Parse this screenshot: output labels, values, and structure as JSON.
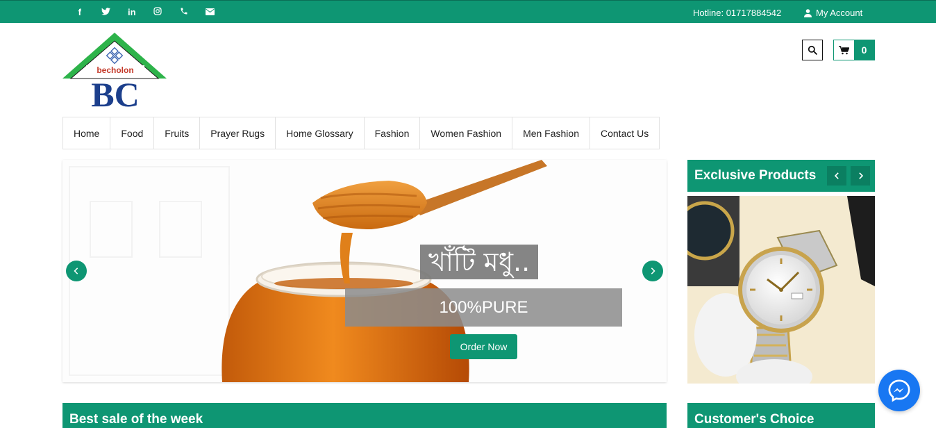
{
  "topbar": {
    "social_icons": [
      "facebook-icon",
      "twitter-icon",
      "linkedin-icon",
      "instagram-icon",
      "phone-icon",
      "envelope-icon"
    ],
    "hotline": "Hotline: 01717884542",
    "account": "My Account"
  },
  "logo": {
    "brand_text": "becholon",
    "monogram": "BC"
  },
  "header": {
    "cart_count": "0"
  },
  "nav": {
    "items": [
      {
        "label": "Home"
      },
      {
        "label": "Food"
      },
      {
        "label": "Fruits"
      },
      {
        "label": "Prayer Rugs"
      },
      {
        "label": "Home Glossary"
      },
      {
        "label": "Fashion"
      },
      {
        "label": "Women Fashion"
      },
      {
        "label": "Men Fashion"
      },
      {
        "label": "Contact Us"
      }
    ]
  },
  "slider": {
    "headline": "খাঁটি মধু..",
    "subline": "100%PURE",
    "cta": "Order Now",
    "prev_icon": "chevron-left-icon",
    "next_icon": "chevron-right-icon"
  },
  "exclusive": {
    "title": "Exclusive Products",
    "prev_icon": "chevron-left-icon",
    "next_icon": "chevron-right-icon"
  },
  "sections": {
    "best_sale": "Best sale of the week",
    "customers_choice": "Customer's Choice"
  },
  "colors": {
    "brand_green": "#0e9673",
    "messenger_blue": "#1877f2"
  }
}
